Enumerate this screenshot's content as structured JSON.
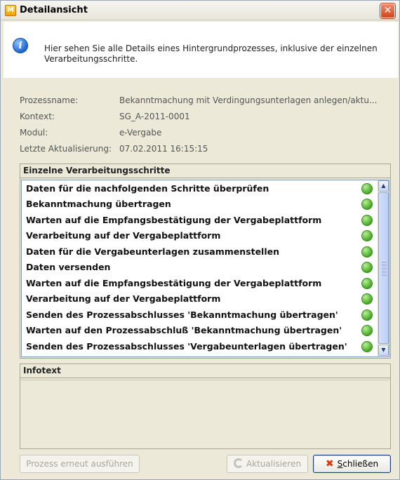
{
  "window": {
    "title": "Detailansicht",
    "app_icon": "app-icon",
    "close_glyph": "✕"
  },
  "info": {
    "icon": "info-icon",
    "text": "Hier sehen Sie alle Details eines Hintergrundprozesses, inklusive der einzelnen Verarbeitungsschritte."
  },
  "properties": [
    {
      "label": "Prozessname:",
      "value": "Bekanntmachung mit Verdingungsunterlagen anlegen/aktu..."
    },
    {
      "label": "Kontext:",
      "value": "SG_A-2011-0001"
    },
    {
      "label": "Modul:",
      "value": "e-Vergabe"
    },
    {
      "label": "Letzte Aktualisierung:",
      "value": "07.02.2011 16:15:15"
    }
  ],
  "steps": {
    "header": "Einzelne Verarbeitungsschritte",
    "items": [
      {
        "label": "Daten für die nachfolgenden Schritte überprüfen",
        "status": "green"
      },
      {
        "label": "Bekanntmachung übertragen",
        "status": "green"
      },
      {
        "label": "Warten auf die Empfangsbestätigung der Vergabeplattform",
        "status": "green"
      },
      {
        "label": "Verarbeitung auf der Vergabeplattform",
        "status": "green"
      },
      {
        "label": "Daten für die Vergabeunterlagen zusammenstellen",
        "status": "green"
      },
      {
        "label": "Daten versenden",
        "status": "green"
      },
      {
        "label": "Warten auf die Empfangsbestätigung der Vergabeplattform",
        "status": "green"
      },
      {
        "label": "Verarbeitung auf der Vergabeplattform",
        "status": "green"
      },
      {
        "label": "Senden des Prozessabschlusses 'Bekanntmachung übertragen'",
        "status": "green"
      },
      {
        "label": "Warten auf den Prozessabschluß 'Bekanntmachung übertragen'",
        "status": "green"
      },
      {
        "label": "Senden des Prozessabschlusses 'Vergabeunterlagen übertragen'",
        "status": "green"
      }
    ]
  },
  "infotext": {
    "header": "Infotext",
    "content": ""
  },
  "buttons": {
    "rerun": "Prozess erneut ausführen",
    "refresh": "Aktualisieren",
    "close_mnemonic": "S",
    "close_rest": "chließen"
  },
  "colors": {
    "status_green": "#4fae2b",
    "titlebar": "#f6f5ef",
    "dialog_bg": "#ece9d8"
  }
}
